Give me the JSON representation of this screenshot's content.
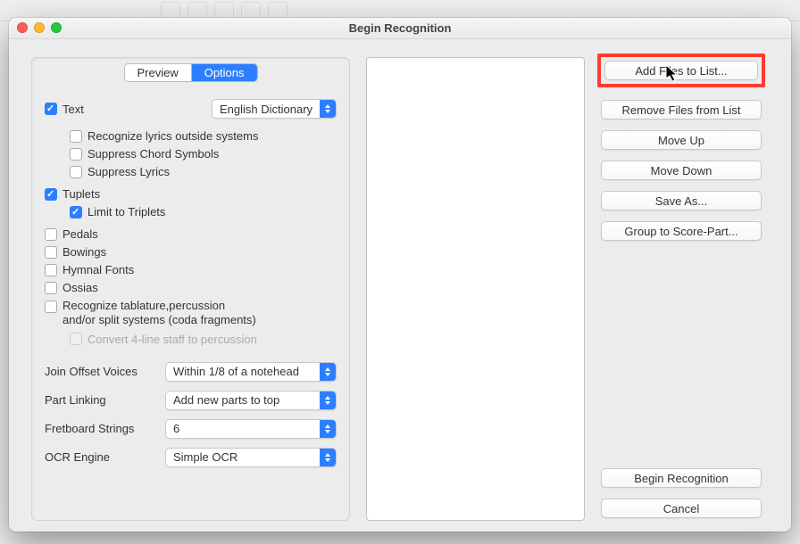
{
  "window": {
    "title": "Begin Recognition"
  },
  "tabs": {
    "preview": "Preview",
    "options": "Options",
    "active": "options"
  },
  "options": {
    "text_cb": {
      "label": "Text",
      "checked": true
    },
    "dict_select": "English Dictionary",
    "recognize_lyrics": {
      "label": "Recognize lyrics outside systems",
      "checked": false
    },
    "suppress_chords": {
      "label": "Suppress Chord Symbols",
      "checked": false
    },
    "suppress_lyrics": {
      "label": "Suppress Lyrics",
      "checked": false
    },
    "tuplets": {
      "label": "Tuplets",
      "checked": true
    },
    "limit_triplets": {
      "label": "Limit to Triplets",
      "checked": true
    },
    "pedals": {
      "label": "Pedals",
      "checked": false
    },
    "bowings": {
      "label": "Bowings",
      "checked": false
    },
    "hymnal_fonts": {
      "label": "Hymnal Fonts",
      "checked": false
    },
    "ossias": {
      "label": "Ossias",
      "checked": false
    },
    "tab_perc": {
      "label": "Recognize tablature,percussion\nand/or split systems (coda fragments)",
      "checked": false
    },
    "convert_4line": {
      "label": "Convert 4-line staff to percussion",
      "checked": false,
      "disabled": true
    },
    "join_offset": {
      "label": "Join Offset Voices",
      "value": "Within 1/8 of a notehead"
    },
    "part_linking": {
      "label": "Part Linking",
      "value": "Add new parts to top"
    },
    "fretboard": {
      "label": "Fretboard Strings",
      "value": "6"
    },
    "ocr_engine": {
      "label": "OCR Engine",
      "value": "Simple OCR"
    }
  },
  "buttons": {
    "add": "Add Files to List...",
    "remove": "Remove Files from List",
    "up": "Move Up",
    "down": "Move Down",
    "saveas": "Save As...",
    "group": "Group to Score-Part...",
    "begin": "Begin Recognition",
    "cancel": "Cancel"
  }
}
